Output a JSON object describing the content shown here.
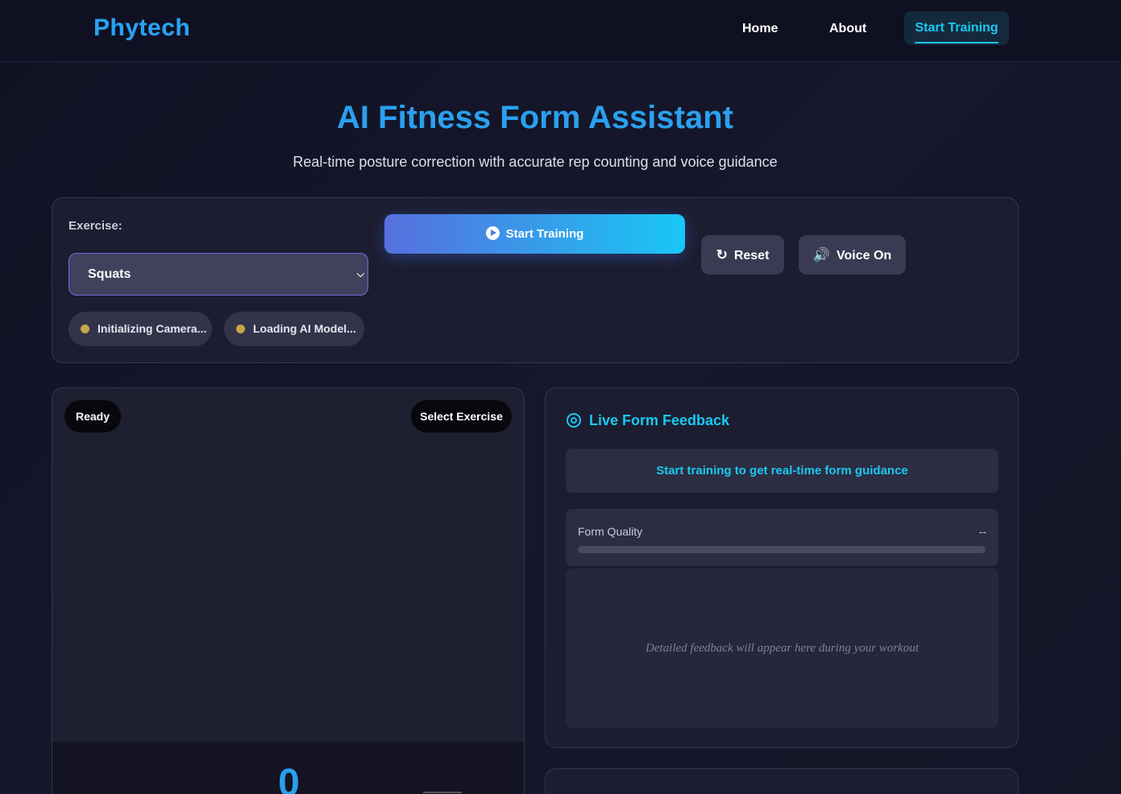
{
  "header": {
    "logo": "Phytech",
    "nav": {
      "home": "Home",
      "about": "About",
      "start_training": "Start Training"
    }
  },
  "hero": {
    "title": "AI Fitness Form Assistant",
    "subtitle": "Real-time posture correction with accurate rep counting and voice guidance"
  },
  "controls": {
    "exercise_label": "Exercise:",
    "exercise_selected": "Squats",
    "start_button": "Start Training",
    "reset_button": "Reset",
    "voice_button": "Voice On",
    "status": {
      "camera": "Initializing Camera...",
      "model": "Loading AI Model..."
    },
    "icons": {
      "start": "play-circle-icon",
      "reset": "redo-icon",
      "voice": "volume-icon"
    }
  },
  "video": {
    "state_badge": "Ready",
    "exercise_badge": "Select Exercise",
    "rep_count": "0"
  },
  "feedback": {
    "title": "Live Form Feedback",
    "prompt": "Start training to get real-time form guidance",
    "form_quality_label": "Form Quality",
    "form_quality_value": "--",
    "detail_placeholder": "Detailed feedback will appear here during your workout"
  },
  "colors": {
    "accent": "#19c9f0",
    "brand": "#2aa0ee",
    "status_pending": "#c9a64a"
  }
}
